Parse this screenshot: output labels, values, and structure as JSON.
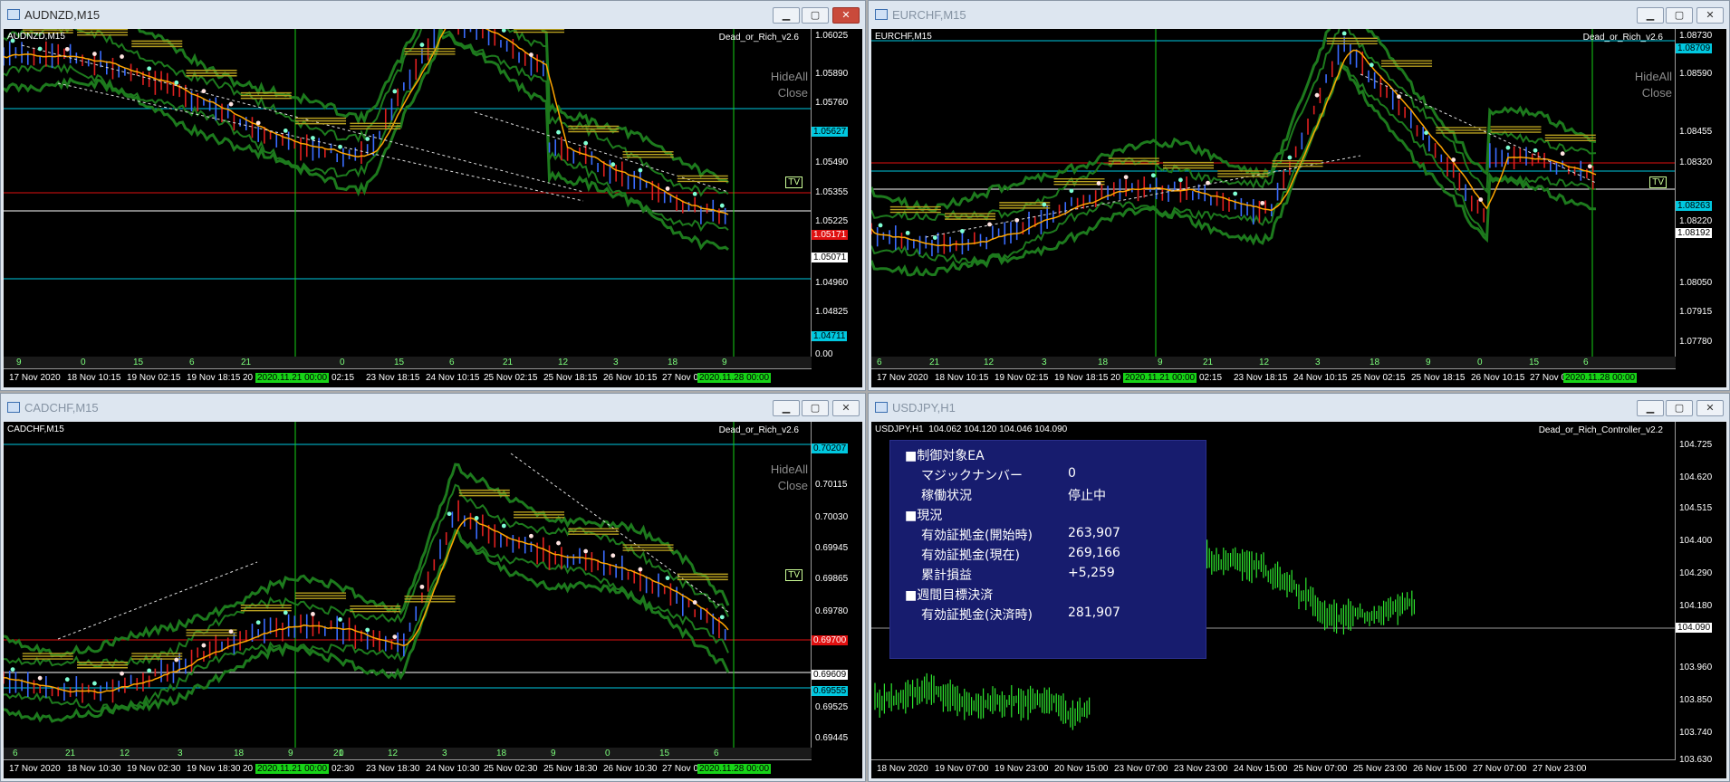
{
  "windows": [
    {
      "title": "AUDNZD,M15",
      "chart_label": "AUDNZD,M15",
      "ea": "Dead_or_Rich_v2.6",
      "hide_all": "HideAll",
      "close_btn": "Close",
      "tv": "TV",
      "price_labels": [
        "1.06025",
        "1.05890",
        "1.05760",
        "1.05490",
        "1.05355",
        "1.05225",
        "1.04960",
        "1.04825",
        "1.04690",
        "0.00"
      ],
      "badges": [
        {
          "text": "1.05627",
          "bg": "#00c8e0",
          "fg": "#000"
        },
        {
          "text": "1.05171",
          "bg": "#e01010",
          "fg": "#fff"
        },
        {
          "text": "1.05071",
          "bg": "#ffffff",
          "fg": "#000"
        },
        {
          "text": "1.04711",
          "bg": "#00c8e0",
          "fg": "#000"
        }
      ],
      "sub_labels": [
        "9",
        "0",
        "15",
        "6",
        "21",
        "0",
        "15",
        "6",
        "21",
        "12",
        "3",
        "18",
        "9"
      ],
      "time_labels": [
        "17 Nov 2020",
        "18 Nov 10:15",
        "19 Nov 02:15",
        "19 Nov 18:15",
        "20",
        "02:15",
        "23 Nov 18:15",
        "24 Nov 10:15",
        "25 Nov 02:15",
        "25 Nov 18:15",
        "26 Nov 10:15",
        "27 Nov 02:"
      ],
      "time_green": [
        "2020.11.21 00:00",
        "2020.11.28 00:00"
      ]
    },
    {
      "title": "EURCHF,M15",
      "chart_label": "EURCHF,M15",
      "ea": "Dead_or_Rich_v2.6",
      "hide_all": "HideAll",
      "close_btn": "Close",
      "tv": "TV",
      "price_labels": [
        "1.08730",
        "1.08590",
        "1.08455",
        "1.08320",
        "1.08220",
        "1.08050",
        "1.07915",
        "1.07780"
      ],
      "badges": [
        {
          "text": "1.08709",
          "bg": "#00c8e0",
          "fg": "#000"
        },
        {
          "text": "1.08263",
          "bg": "#00c8e0",
          "fg": "#000"
        },
        {
          "text": "1.08192",
          "bg": "#ffffff",
          "fg": "#000"
        }
      ],
      "sub_labels": [
        "6",
        "21",
        "12",
        "3",
        "18",
        "9",
        "21",
        "12",
        "3",
        "18",
        "9",
        "0",
        "15",
        "6"
      ],
      "time_labels": [
        "17 Nov 2020",
        "18 Nov 10:15",
        "19 Nov 02:15",
        "19 Nov 18:15",
        "20",
        "02:15",
        "23 Nov 18:15",
        "24 Nov 10:15",
        "25 Nov 02:15",
        "25 Nov 18:15",
        "26 Nov 10:15",
        "27 Nov 02:"
      ],
      "time_green": [
        "2020.11.21 00:00",
        "2020.11.28 00:00"
      ]
    },
    {
      "title": "CADCHF,M15",
      "chart_label": "CADCHF,M15",
      "ea": "Dead_or_Rich_v2.6",
      "hide_all": "HideAll",
      "close_btn": "Close",
      "tv": "TV",
      "price_labels": [
        "0.70115",
        "0.70030",
        "0.69945",
        "0.69865",
        "0.69780",
        "0.69525",
        "0.69445"
      ],
      "badges": [
        {
          "text": "0.70207",
          "bg": "#00c8e0",
          "fg": "#000"
        },
        {
          "text": "0.69700",
          "bg": "#e01010",
          "fg": "#fff"
        },
        {
          "text": "0.69609",
          "bg": "#ffffff",
          "fg": "#000"
        },
        {
          "text": "0.69555",
          "bg": "#00c8e0",
          "fg": "#000"
        }
      ],
      "sub_labels": [
        "6",
        "21",
        "12",
        "3",
        "18",
        "9",
        "0",
        "21",
        "12",
        "3",
        "18",
        "9",
        "0",
        "15",
        "6"
      ],
      "time_labels": [
        "17 Nov 2020",
        "18 Nov 10:30",
        "19 Nov 02:30",
        "19 Nov 18:30",
        "20",
        "02:30",
        "23 Nov 18:30",
        "24 Nov 10:30",
        "25 Nov 02:30",
        "25 Nov 18:30",
        "26 Nov 10:30",
        "27 Nov 02:"
      ],
      "time_green": [
        "2020.11.21 00:00",
        "2020.11.28 00:00"
      ]
    }
  ],
  "usdjpy": {
    "title": "USDJPY,H1",
    "chart_label": "USDJPY,H1",
    "quote": "104.062 104.120 104.046 104.090",
    "ea": "Dead_or_Rich_Controller_v2.2",
    "price_labels": [
      "104.725",
      "104.620",
      "104.515",
      "104.400",
      "104.290",
      "104.180",
      "103.960",
      "103.850",
      "103.740",
      "103.630"
    ],
    "current_price": "104.090",
    "time_labels": [
      "18 Nov 2020",
      "19 Nov 07:00",
      "19 Nov 23:00",
      "20 Nov 15:00",
      "23 Nov 07:00",
      "23 Nov 23:00",
      "24 Nov 15:00",
      "25 Nov 07:00",
      "25 Nov 23:00",
      "26 Nov 15:00",
      "27 Nov 07:00",
      "27 Nov 23:00"
    ],
    "panel": {
      "h1": "■制御対象EA",
      "magic_label": "マジックナンバー",
      "magic_value": "0",
      "status_label": "稼働状況",
      "status_value": "停止中",
      "h2": "■現況",
      "eq_start_label": "有効証拠金(開始時)",
      "eq_start_value": "263,907",
      "eq_now_label": "有効証拠金(現在)",
      "eq_now_value": "269,166",
      "pl_label": "累計損益",
      "pl_value": "+5,259",
      "h3": "■週間目標決済",
      "eq_target_label": "有効証拠金(決済時)",
      "eq_target_value": "281,907"
    }
  },
  "colors": {
    "band": "#1d7a1d",
    "ma": "#ffa500",
    "bull": "#3a6cff",
    "bear": "#e02020",
    "grid": "#16d016",
    "cyan": "#00c8e0",
    "red": "#e01010",
    "gold": "#b8a020"
  }
}
